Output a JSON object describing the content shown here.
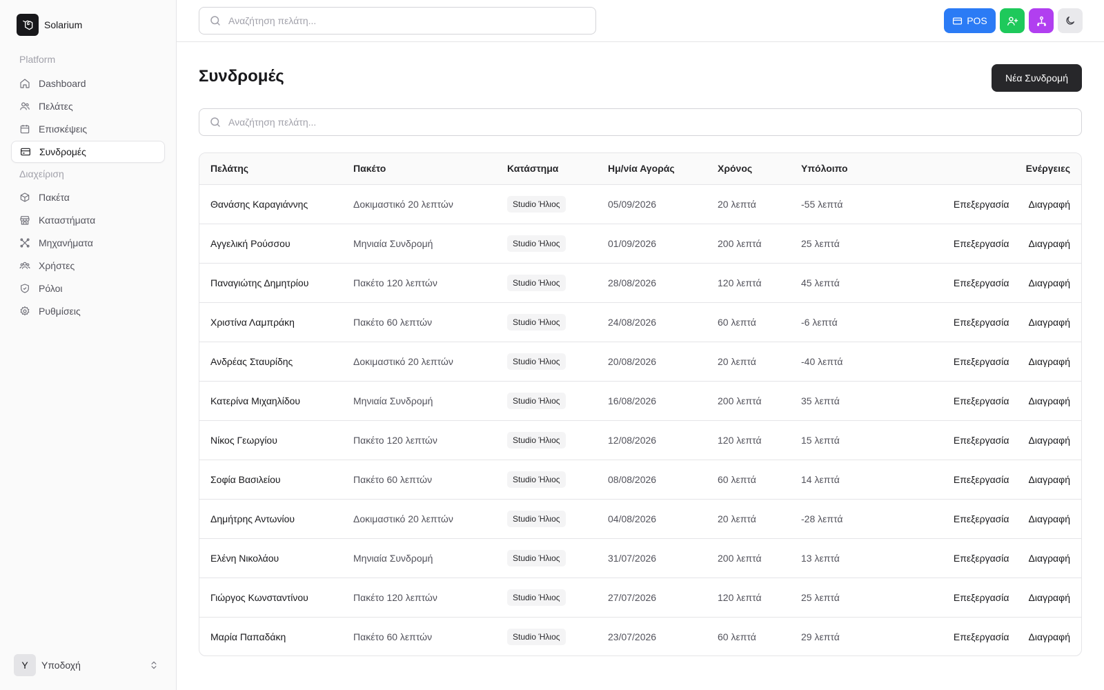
{
  "brand": {
    "name": "Solarium"
  },
  "sidebar": {
    "groups": [
      {
        "label": "Platform"
      },
      {
        "label": "Διαχείριση"
      }
    ],
    "items": [
      {
        "label": "Dashboard",
        "icon": "home-icon"
      },
      {
        "label": "Πελάτες",
        "icon": "users-icon"
      },
      {
        "label": "Επισκέψεις",
        "icon": "calendar-icon"
      },
      {
        "label": "Συνδρομές",
        "icon": "credit-card-icon",
        "active": true
      },
      {
        "label": "Πακέτα",
        "icon": "package-icon"
      },
      {
        "label": "Καταστήματα",
        "icon": "store-icon"
      },
      {
        "label": "Μηχανήματα",
        "icon": "machine-icon"
      },
      {
        "label": "Χρήστες",
        "icon": "user-group-icon"
      },
      {
        "label": "Ρόλοι",
        "icon": "shield-icon"
      },
      {
        "label": "Ρυθμίσεις",
        "icon": "gear-icon"
      }
    ],
    "user": {
      "initial": "Y",
      "name": "Υποδοχή"
    }
  },
  "header": {
    "search_placeholder": "Αναζήτηση πελάτη...",
    "pos_label": "POS",
    "colors": {
      "pos": "#2b7bf5",
      "add_customer": "#1ec95b",
      "group": "#b13ff0",
      "theme": "#e9e9ec"
    }
  },
  "main": {
    "title": "Συνδρομές",
    "new_button": "Νέα Συνδρομή",
    "search_placeholder": "Αναζήτηση πελάτη...",
    "table": {
      "headers": [
        "Πελάτης",
        "Πακέτο",
        "Κατάστημα",
        "Ημ/νία Αγοράς",
        "Χρόνος",
        "Υπόλοιπο",
        "Ενέργειες"
      ],
      "edit_label": "Επεξεργασία",
      "delete_label": "Διαγραφή",
      "rows": [
        {
          "customer": "Θανάσης Καραγιάννης",
          "package": "Δοκιμαστικό 20 λεπτών",
          "store": "Studio Ήλιος",
          "date": "05/09/2026",
          "time": "20 λεπτά",
          "remaining": "-55 λεπτά"
        },
        {
          "customer": "Αγγελική Ρούσσου",
          "package": "Μηνιαία Συνδρομή",
          "store": "Studio Ήλιος",
          "date": "01/09/2026",
          "time": "200 λεπτά",
          "remaining": "25 λεπτά"
        },
        {
          "customer": "Παναγιώτης Δημητρίου",
          "package": "Πακέτο 120 λεπτών",
          "store": "Studio Ήλιος",
          "date": "28/08/2026",
          "time": "120 λεπτά",
          "remaining": "45 λεπτά"
        },
        {
          "customer": "Χριστίνα Λαμπράκη",
          "package": "Πακέτο 60 λεπτών",
          "store": "Studio Ήλιος",
          "date": "24/08/2026",
          "time": "60 λεπτά",
          "remaining": "-6 λεπτά"
        },
        {
          "customer": "Ανδρέας Σταυρίδης",
          "package": "Δοκιμαστικό 20 λεπτών",
          "store": "Studio Ήλιος",
          "date": "20/08/2026",
          "time": "20 λεπτά",
          "remaining": "-40 λεπτά"
        },
        {
          "customer": "Κατερίνα Μιχαηλίδου",
          "package": "Μηνιαία Συνδρομή",
          "store": "Studio Ήλιος",
          "date": "16/08/2026",
          "time": "200 λεπτά",
          "remaining": "35 λεπτά"
        },
        {
          "customer": "Νίκος Γεωργίου",
          "package": "Πακέτο 120 λεπτών",
          "store": "Studio Ήλιος",
          "date": "12/08/2026",
          "time": "120 λεπτά",
          "remaining": "15 λεπτά"
        },
        {
          "customer": "Σοφία Βασιλείου",
          "package": "Πακέτο 60 λεπτών",
          "store": "Studio Ήλιος",
          "date": "08/08/2026",
          "time": "60 λεπτά",
          "remaining": "14 λεπτά"
        },
        {
          "customer": "Δημήτρης Αντωνίου",
          "package": "Δοκιμαστικό 20 λεπτών",
          "store": "Studio Ήλιος",
          "date": "04/08/2026",
          "time": "20 λεπτά",
          "remaining": "-28 λεπτά"
        },
        {
          "customer": "Ελένη Νικολάου",
          "package": "Μηνιαία Συνδρομή",
          "store": "Studio Ήλιος",
          "date": "31/07/2026",
          "time": "200 λεπτά",
          "remaining": "13 λεπτά"
        },
        {
          "customer": "Γιώργος Κωνσταντίνου",
          "package": "Πακέτο 120 λεπτών",
          "store": "Studio Ήλιος",
          "date": "27/07/2026",
          "time": "120 λεπτά",
          "remaining": "25 λεπτά"
        },
        {
          "customer": "Μαρία Παπαδάκη",
          "package": "Πακέτο 60 λεπτών",
          "store": "Studio Ήλιος",
          "date": "23/07/2026",
          "time": "60 λεπτά",
          "remaining": "29 λεπτά"
        }
      ]
    }
  }
}
